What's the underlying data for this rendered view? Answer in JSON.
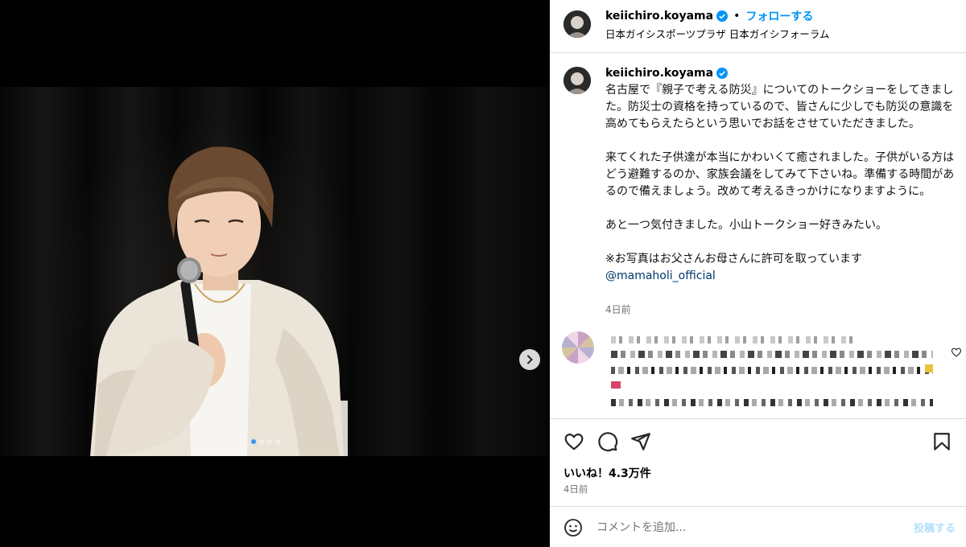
{
  "post": {
    "username": "keiichiro.koyama",
    "follow_label": "フォローする",
    "separator": "•",
    "location": "日本ガイシスポーツプラザ 日本ガイシフォーラム",
    "caption_paragraphs": [
      "名古屋で『親子で考える防災』についてのトークショーをしてきました。防災士の資格を持っているので、皆さんに少しでも防災の意識を高めてもらえたらという思いでお話をさせていただきました。",
      "来てくれた子供達が本当にかわいくて癒されました。子供がいる方はどう避難するのか、家族会議をしてみて下さいね。準備する時間があるので備えましょう。改めて考えるきっかけになりますように。",
      "あと一つ気付きました。小山トークショー好きみたい。"
    ],
    "caption_note": "※お写真はお父さんお母さんに許可を取っています",
    "caption_mention": "@mamaholi_official",
    "caption_time": "4日前",
    "likes": "いいね！4.3万件",
    "post_time": "4日前",
    "comment_placeholder": "コメントを追加...",
    "post_button": "投稿する"
  },
  "carousel": {
    "slide_count": 4,
    "active_index": 0
  },
  "icons": {
    "verified": "verified-badge-icon",
    "next": "chevron-right-icon",
    "like": "heart-icon",
    "comment": "comment-bubble-icon",
    "share": "paper-plane-icon",
    "save": "bookmark-icon",
    "emoji": "smiley-icon",
    "comment_like": "small-heart-icon"
  },
  "colors": {
    "accent": "#0095f6",
    "verified": "#0095f6",
    "mention": "#00376b",
    "muted": "#737373",
    "border": "#dbdbdb"
  }
}
